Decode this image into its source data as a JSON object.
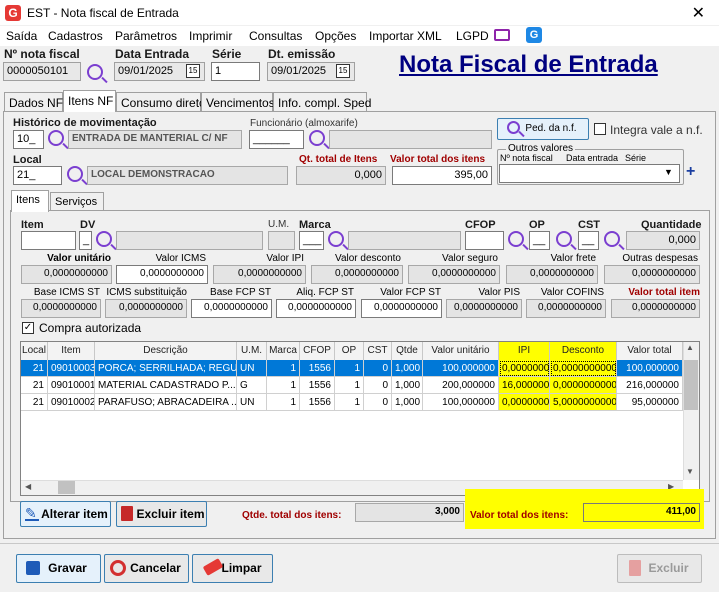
{
  "window": {
    "title": "EST - Nota fiscal de Entrada",
    "logo": "G",
    "close": "✕"
  },
  "menu": [
    "Saída",
    "Cadastros",
    "Parâmetros",
    "Imprimir",
    "Consultas",
    "Opções",
    "Importar XML",
    "LGPD"
  ],
  "header": {
    "nf_label": "Nº nota fiscal",
    "nf_value": "0000050101",
    "entrada_label": "Data Entrada",
    "entrada_value": "09/01/2025",
    "serie_label": "Série",
    "serie_value": "1",
    "emissao_label": "Dt. emissão",
    "emissao_value": "09/01/2025",
    "cal_icon_text": "15",
    "big_title": "Nota Fiscal de Entrada"
  },
  "tabs": [
    "Dados NF",
    "Itens NF",
    "Consumo direto",
    "Vencimentos",
    "Info. compl. Sped"
  ],
  "top": {
    "hist_label": "Histórico de movimentação",
    "hist_code": "10_",
    "hist_desc": "ENTRADA DE MANTERIAL C/ NF",
    "func_label": "Funcionário (almoxarife)",
    "func_code": "______",
    "ped_btn": "Ped. da n.f.",
    "integra_label": "Integra vale a n.f.",
    "local_label": "Local",
    "local_code": "21_",
    "local_desc": "LOCAL DEMONSTRACAO",
    "qt_total_label": "Qt. total de Itens",
    "qt_total_value": "0,000",
    "valor_total_label": "Valor total dos itens",
    "valor_total_value": "395,00",
    "outros_label": "Outros valores",
    "outros_cols": [
      "Nº nota fiscal",
      "Data entrada",
      "Série"
    ],
    "plus": "+"
  },
  "subtabs": [
    "Itens",
    "Serviços"
  ],
  "item_form": {
    "item_label": "Item",
    "dv_label": "DV",
    "dv_value": "_",
    "um_label": "U.M.",
    "marca_label": "Marca",
    "marca_value": "___",
    "cfop_label": "CFOP",
    "op_label": "OP",
    "op_value": "__",
    "cst_label": "CST",
    "cst_value": "__",
    "qtd_label": "Quantidade",
    "qtd_value": "0,000",
    "row2": [
      {
        "label": "Valor unitário",
        "value": "0,0000000000",
        "bold": true
      },
      {
        "label": "Valor ICMS",
        "value": "0,0000000000"
      },
      {
        "label": "Valor IPI",
        "value": "0,0000000000"
      },
      {
        "label": "Valor desconto",
        "value": "0,0000000000"
      },
      {
        "label": "Valor seguro",
        "value": "0,0000000000"
      },
      {
        "label": "Valor frete",
        "value": "0,0000000000"
      },
      {
        "label": "Outras despesas",
        "value": "0,0000000000"
      }
    ],
    "row3": [
      {
        "label": "Base ICMS ST",
        "value": "0,0000000000"
      },
      {
        "label": "ICMS substituição",
        "value": "0,0000000000"
      },
      {
        "label": "Base FCP ST",
        "value": "0,0000000000"
      },
      {
        "label": "Aliq. FCP ST",
        "value": "0,0000000000"
      },
      {
        "label": "Valor FCP ST",
        "value": "0,0000000000"
      },
      {
        "label": "Valor PIS",
        "value": "0,0000000000"
      },
      {
        "label": "Valor COFINS",
        "value": "0,0000000000"
      },
      {
        "label": "Valor total item",
        "value": "0,0000000000"
      }
    ],
    "compra_label": "Compra autorizada",
    "compra_checked": "✓"
  },
  "grid": {
    "headers": [
      "Local",
      "Item",
      "Descrição",
      "U.M.",
      "Marca",
      "CFOP",
      "OP",
      "CST",
      "Qtde",
      "Valor unitário",
      "IPI",
      "Desconto",
      "Valor total"
    ],
    "rows": [
      [
        "21",
        "09010003",
        "PORCA; SERRILHADA; REGU...",
        "UN",
        "1",
        "1556",
        "1",
        "0",
        "1,000",
        "100,000000",
        "0,0000000...",
        "0,0000000000",
        "100,000000"
      ],
      [
        "21",
        "09010001",
        "MATERIAL CADASTRADO P...",
        "G",
        "1",
        "1556",
        "1",
        "0",
        "1,000",
        "200,000000",
        "16,000000...",
        "0,0000000000",
        "216,000000"
      ],
      [
        "21",
        "09010002",
        "PARAFUSO; ABRACADEIRA ...",
        "UN",
        "1",
        "1556",
        "1",
        "0",
        "1,000",
        "100,000000",
        "0,0000000...",
        "5,0000000000",
        "95,000000"
      ]
    ],
    "scroll_up": "▲",
    "scroll_down": "▼",
    "scroll_left": "◀",
    "scroll_right": "▶"
  },
  "bottom": {
    "alterar": "Alterar item",
    "excluir_item": "Excluir item",
    "qtde_total_label": "Qtde. total dos itens:",
    "qtde_total_value": "3,000",
    "valor_total_label": "Valor total dos itens:",
    "valor_total_value": "411,00"
  },
  "footer": {
    "gravar": "Gravar",
    "cancelar": "Cancelar",
    "limpar": "Limpar",
    "excluir": "Excluir"
  },
  "colors": {
    "accent": "#7b3fd0",
    "selection": "#0078d7",
    "highlight": "#ffff00",
    "title": "#000080",
    "red": "#a00000"
  }
}
